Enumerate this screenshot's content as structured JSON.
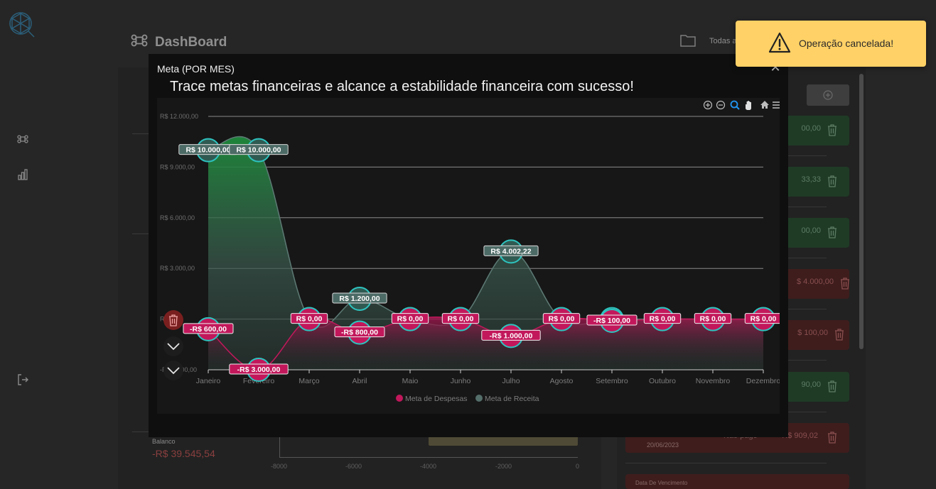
{
  "header": {
    "title": "DashBoard",
    "filter_label": "Todas a"
  },
  "balance": {
    "label": "Balanco",
    "value": "-R$ 39.545,54"
  },
  "background_chart": {
    "x_ticks": [
      "-8000",
      "-6000",
      "-4000",
      "-2000",
      "0"
    ]
  },
  "transactions": [
    {
      "amount": "00,00",
      "color": "green"
    },
    {
      "amount": "33,33",
      "color": "green"
    },
    {
      "amount": "00,00",
      "color": "green"
    },
    {
      "amount": "$ 4.000,00",
      "color": "red"
    },
    {
      "amount": "$ 100,00",
      "color": "red"
    },
    {
      "amount": "90,00",
      "color": "green"
    },
    {
      "amount": "R$ 909,02",
      "color": "red",
      "status": "Não pago",
      "date": "20/06/2023"
    }
  ],
  "partial_row_label": "Data De Vencimento",
  "modal": {
    "title": "Meta (POR MES)",
    "heading": "Trace metas financeiras e alcance a estabilidade financeira com sucesso!"
  },
  "toast": {
    "message": "Operação cancelada!",
    "icon": "warning-icon",
    "background": "#ffd166"
  },
  "chart_data": {
    "type": "area",
    "categories": [
      "Janeiro",
      "Fevereiro",
      "Março",
      "Abril",
      "Maio",
      "Junho",
      "Julho",
      "Agosto",
      "Setembro",
      "Outubro",
      "Novembro",
      "Dezembro"
    ],
    "y_ticks": [
      "R$ 12.000,00",
      "R$ 9.000,00",
      "R$ 6.000,00",
      "R$ 3.000,00",
      "R$ 0,00",
      "-R$ 3.000,00"
    ],
    "ylim": [
      -3000,
      12000
    ],
    "grid": true,
    "legend_position": "bottom",
    "series": [
      {
        "name": "Meta de Despesas",
        "color": "#c2185b",
        "values": [
          -600,
          -3000,
          0,
          -800,
          0,
          0,
          -1000,
          0,
          -100,
          0,
          0,
          0
        ],
        "labels": [
          "-R$ 600,00",
          "-R$ 3.000,00",
          "R$ 0,00",
          "-R$ 800,00",
          "R$ 0,00",
          "R$ 0,00",
          "-R$ 1.000,00",
          "R$ 0,00",
          "-R$ 100,00",
          "R$ 0,00",
          "R$ 0,00",
          "R$ 0,00"
        ]
      },
      {
        "name": "Meta de Receita",
        "color": "#546e6a",
        "values": [
          10000,
          10000,
          0,
          1200,
          0,
          0,
          4002.22,
          0,
          0,
          0,
          0,
          0
        ],
        "labels": [
          "R$ 10.000,00",
          "R$ 10.000,00",
          "",
          "R$ 1.200,00",
          "",
          "",
          "R$ 4.002,22",
          "",
          "",
          "",
          "",
          ""
        ]
      }
    ]
  }
}
